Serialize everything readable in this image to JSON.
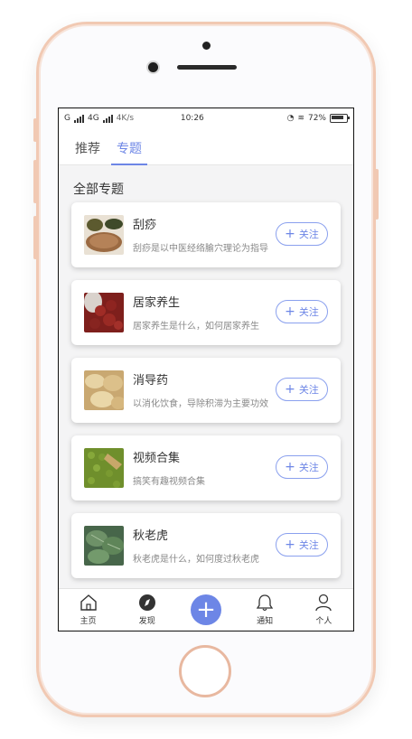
{
  "status_bar": {
    "carrier": "G",
    "network": "4G",
    "speed": "4K/s",
    "time": "10:26",
    "battery": "72%"
  },
  "tabs": [
    {
      "label": "推荐",
      "active": false
    },
    {
      "label": "专题",
      "active": true
    }
  ],
  "section_title": "全部专题",
  "topics": [
    {
      "title": "刮痧",
      "desc": "刮痧是以中医经络腧穴理论为指导",
      "follow_label": "关注",
      "thumb": "herb-icon"
    },
    {
      "title": "居家养生",
      "desc": "居家养生是什么，如何居家养生",
      "follow_label": "关注",
      "thumb": "beans-icon"
    },
    {
      "title": "消导药",
      "desc": "以消化饮食，导除积滞为主要功效",
      "follow_label": "关注",
      "thumb": "slices-icon"
    },
    {
      "title": "视频合集",
      "desc": "搞笑有趣视频合集",
      "follow_label": "关注",
      "thumb": "greenbeans-icon"
    },
    {
      "title": "秋老虎",
      "desc": "秋老虎是什么，如何度过秋老虎",
      "follow_label": "关注",
      "thumb": "leaves-icon"
    }
  ],
  "bottom_nav": {
    "home": "主页",
    "discover": "发现",
    "add": "+",
    "notify": "通知",
    "me": "个人"
  },
  "colors": {
    "accent": "#6d86e6",
    "frame": "#f1c9b3"
  }
}
